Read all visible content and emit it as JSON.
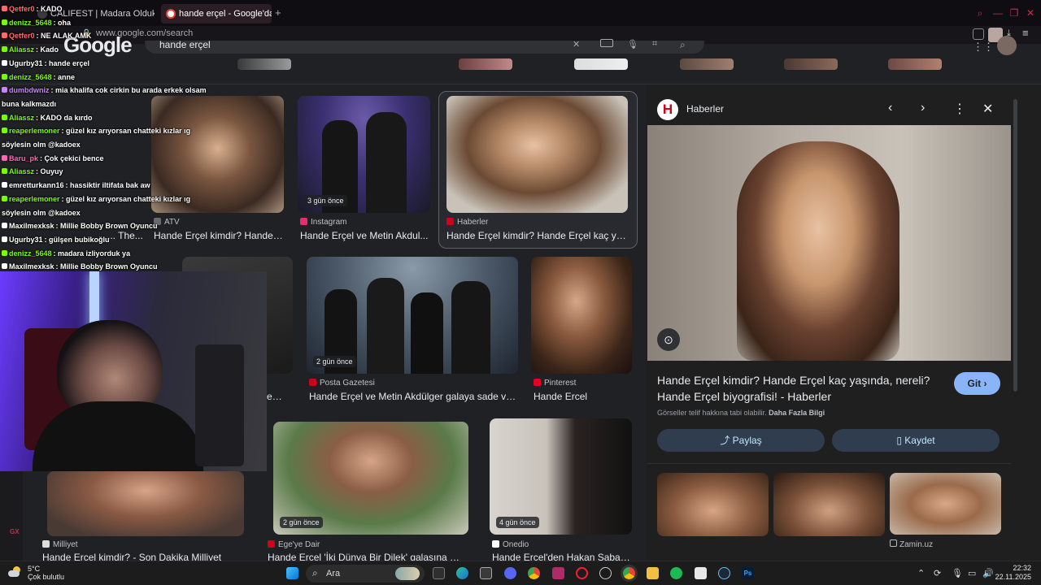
{
  "browser": {
    "tabs": [
      {
        "label": "CALIFEST | Madara Olduk",
        "active": false
      },
      {
        "label": "hande erçel - Google'da a",
        "active": true
      }
    ],
    "new_tab": "+",
    "url": "www.google.com/search"
  },
  "google": {
    "logo": "Google",
    "query": "hande erçel"
  },
  "results": [
    {
      "source": "ATV",
      "title": "Hande Erçel kimdir? Hande ...",
      "ago": ""
    },
    {
      "source": "Instagram",
      "title": "Hande Erçel ve Metin Akdul...",
      "ago": "3 gün önce"
    },
    {
      "source": "Haberler",
      "title": "Hande Erçel kimdir? Hande Erçel kaç yaş...",
      "ago": ""
    },
    {
      "source": "",
      "title": "... The...",
      "ago": ""
    },
    {
      "source": "",
      "title": "emi...",
      "ago": ""
    },
    {
      "source": "Posta Gazetesi",
      "title": "Hande Erçel ve Metin Akdülger galaya sade ve ...",
      "ago": "2 gün önce"
    },
    {
      "source": "Pinterest",
      "title": "Hande Ercel",
      "ago": ""
    },
    {
      "source": "Milliyet",
      "title": "Hande Erçel kimdir? - Son Dakika Milliyet",
      "ago": ""
    },
    {
      "source": "Ege'ye Dair",
      "title": "Hande Erçel 'İki Dünya Bir Dilek' galasına dam...",
      "ago": "2 gün önce"
    },
    {
      "source": "Onedio",
      "title": "Hande Erçel'den Hakan Sabancı...",
      "ago": "4 gün önce"
    }
  ],
  "panel": {
    "source": "Haberler",
    "logo_letter": "H",
    "title": "Hande Erçel kimdir? Hande Erçel kaç yaşında, nereli? Hande Erçel biyografisi! - Haberler",
    "go_label": "Git ›",
    "copyright": "Görseller telif hakkına tabi olabilir.",
    "more_info": "Daha Fazla Bilgi",
    "share_label": "Paylaş",
    "save_label": "Kaydet",
    "related_source": "Zamin.uz"
  },
  "chat": [
    {
      "user": "Qetfer0",
      "text": "KADO",
      "color": "#ff6b6b"
    },
    {
      "user": "denizz_5648",
      "text": "oha",
      "color": "#7cfc00"
    },
    {
      "user": "Qetfer0",
      "text": "NE ALAK AMK",
      "color": "#ff6b6b"
    },
    {
      "user": "Aliassz",
      "text": "Kado",
      "color": "#7cfc00"
    },
    {
      "user": "Ugurby31",
      "text": "hande erçel",
      "color": "#ffffff"
    },
    {
      "user": "denizz_5648",
      "text": "anne",
      "color": "#7cfc00"
    },
    {
      "user": "dumbdwniz",
      "text": "mia khalifa cok cirkin bu arada erkek olsam",
      "color": "#c586ff"
    },
    {
      "user": "",
      "text": "buna kalkmazdı",
      "color": "#ffffff"
    },
    {
      "user": "Aliassz",
      "text": "KADO da kırdo",
      "color": "#7cfc00"
    },
    {
      "user": "reaperlemoner",
      "text": "güzel kız arıyorsan chatteki kızlar ıg",
      "color": "#7cfc00"
    },
    {
      "user": "",
      "text": "söylesin olm @kadoex",
      "color": "#ffffff"
    },
    {
      "user": "Baru_pk",
      "text": "Çok çekici bence",
      "color": "#ff69b4"
    },
    {
      "user": "Aliassz",
      "text": "Ouyuy",
      "color": "#7cfc00"
    },
    {
      "user": "emretturkann16",
      "text": "hassiktir iltifata bak aw",
      "color": "#ffffff"
    },
    {
      "user": "reaperlemoner",
      "text": "güzel kız arıyorsan chatteki kızlar ıg",
      "color": "#7cfc00"
    },
    {
      "user": "",
      "text": "söylesin olm @kadoex",
      "color": "#ffffff"
    },
    {
      "user": "Maxilmexksk",
      "text": "Millie Bobby Brown Oyuncu",
      "color": "#ffffff"
    },
    {
      "user": "Ugurby31",
      "text": "gülşen bubikoğlu",
      "color": "#ffffff"
    },
    {
      "user": "denizz_5648",
      "text": "madara izliyorduk ya",
      "color": "#7cfc00"
    },
    {
      "user": "Maxilmexksk",
      "text": "Millie Bobby Brown Oyuncu",
      "color": "#ffffff"
    }
  ],
  "taskbar": {
    "temp": "5°C",
    "weather": "Çok bulutlu",
    "search_label": "Ara",
    "time": "22:32",
    "date": "22.11.2025",
    "gx": "GX"
  }
}
